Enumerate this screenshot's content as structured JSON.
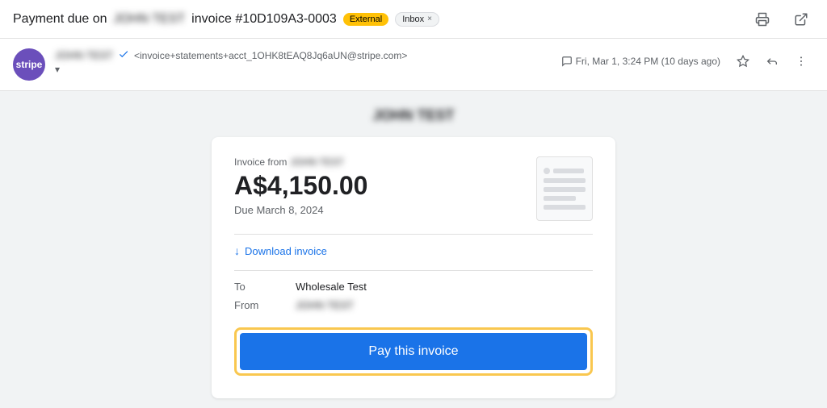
{
  "topbar": {
    "title_prefix": "Payment due on",
    "title_blurred": "JOHN TEST",
    "title_invoice": "invoice #10D109A3-0003",
    "badge_external": "External",
    "badge_inbox": "Inbox",
    "badge_inbox_close": "×",
    "print_icon": "🖨",
    "open_icon": "⤢"
  },
  "email_header": {
    "avatar_text": "stripe",
    "sender_name": "JOHN TEST",
    "verified_icon": "✔",
    "sender_email": "<invoice+statements+acct_1OHK8tEAQ8Jq6aUN@stripe.com>",
    "subline_arrow": "▾",
    "chat_icon": "💬",
    "date_text": "Fri, Mar 1, 3:24 PM (10 days ago)",
    "star_icon": "☆",
    "reply_icon": "↩",
    "more_icon": "⋮"
  },
  "email_body": {
    "sender_name_centered": "JOHN TEST"
  },
  "invoice": {
    "from_label": "Invoice from",
    "from_name": "JOHN TEST",
    "amount": "A$4,150.00",
    "due_date": "Due March 8, 2024",
    "download_label": "Download invoice",
    "field_to_label": "To",
    "field_to_value": "Wholesale Test",
    "field_from_label": "From",
    "field_from_value": "JOHN TEST",
    "pay_button_label": "Pay this invoice"
  }
}
